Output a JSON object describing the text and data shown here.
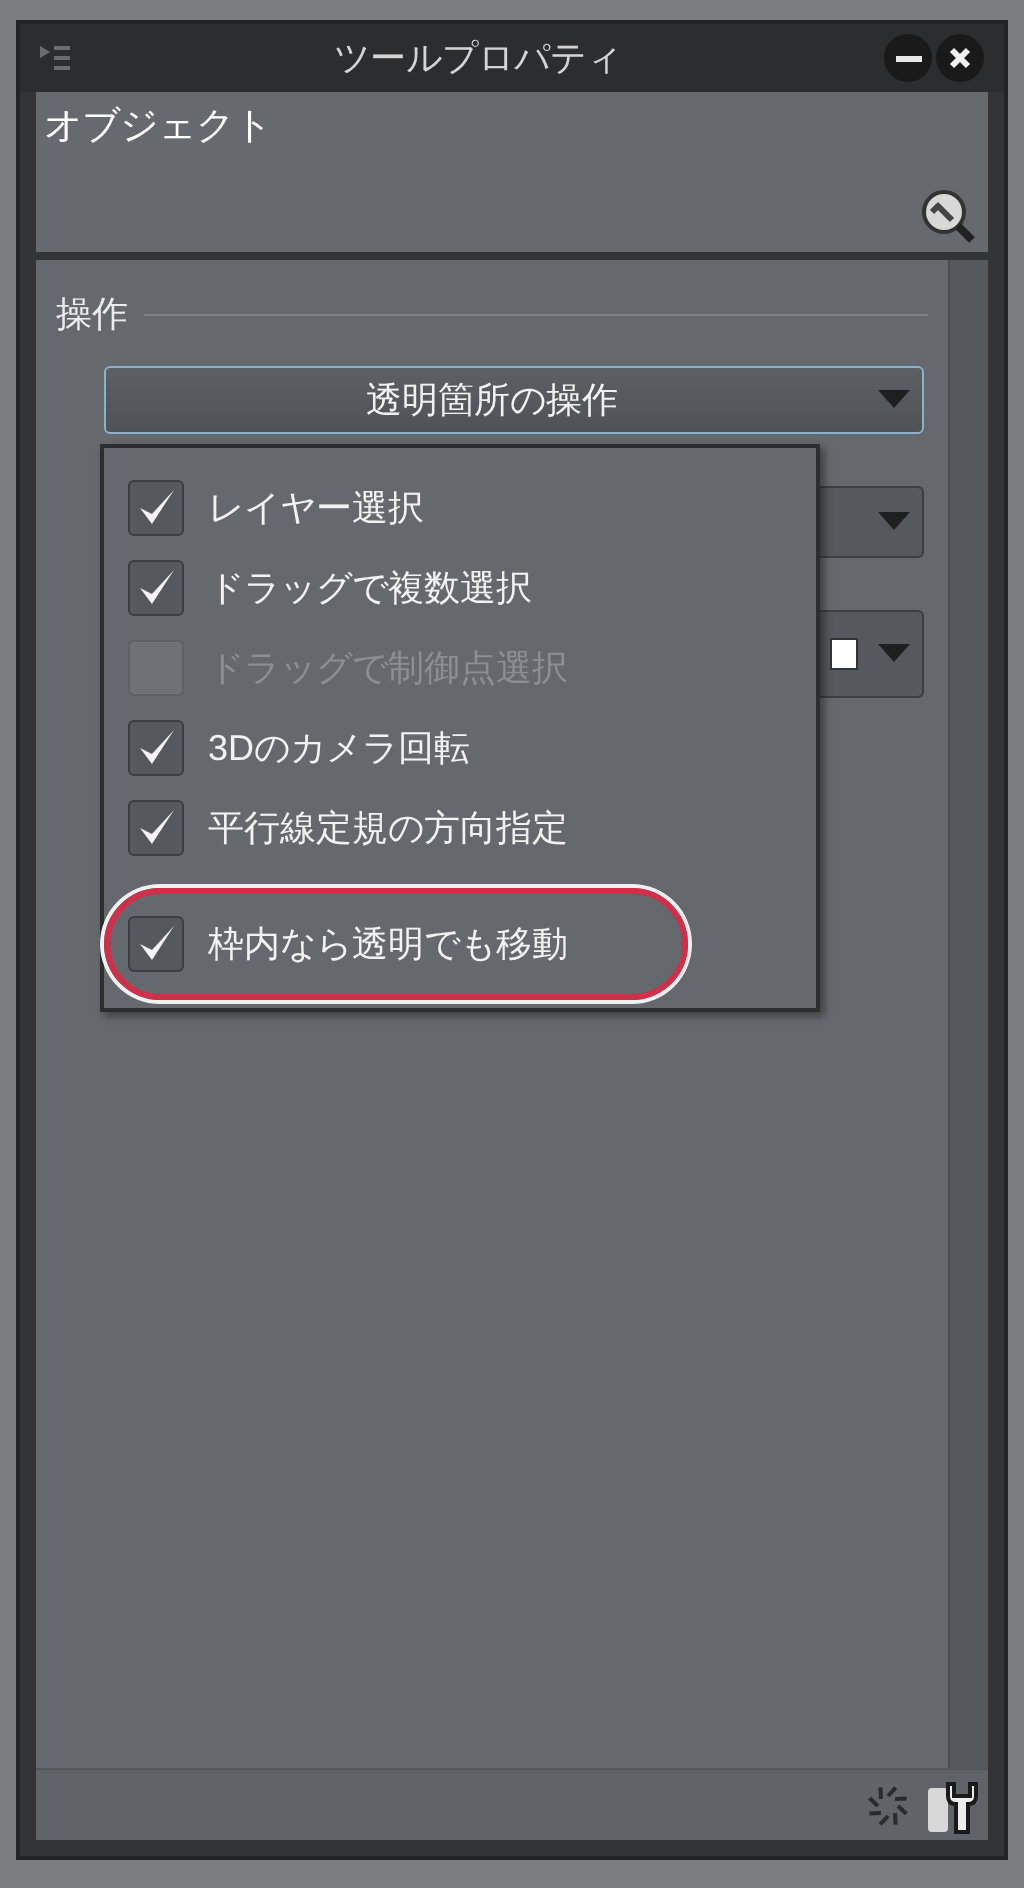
{
  "window": {
    "title": "ツールプロパティ"
  },
  "header": {
    "title": "オブジェクト"
  },
  "section": {
    "title": "操作",
    "dropdown": {
      "value": "透明箇所の操作",
      "expanded": true
    },
    "menu": {
      "items": [
        {
          "label": "レイヤー選択",
          "checked": true,
          "disabled": false,
          "circled": false
        },
        {
          "label": "ドラッグで複数選択",
          "checked": true,
          "disabled": false,
          "circled": false
        },
        {
          "label": "ドラッグで制御点選択",
          "checked": false,
          "disabled": true,
          "circled": false
        },
        {
          "label": "3Dのカメラ回転",
          "checked": true,
          "disabled": false,
          "circled": false
        },
        {
          "label": "平行線定規の方向指定",
          "checked": true,
          "disabled": false,
          "circled": false
        },
        {
          "label": "枠内なら透明でも移動",
          "checked": true,
          "disabled": false,
          "circled": true
        }
      ]
    }
  }
}
